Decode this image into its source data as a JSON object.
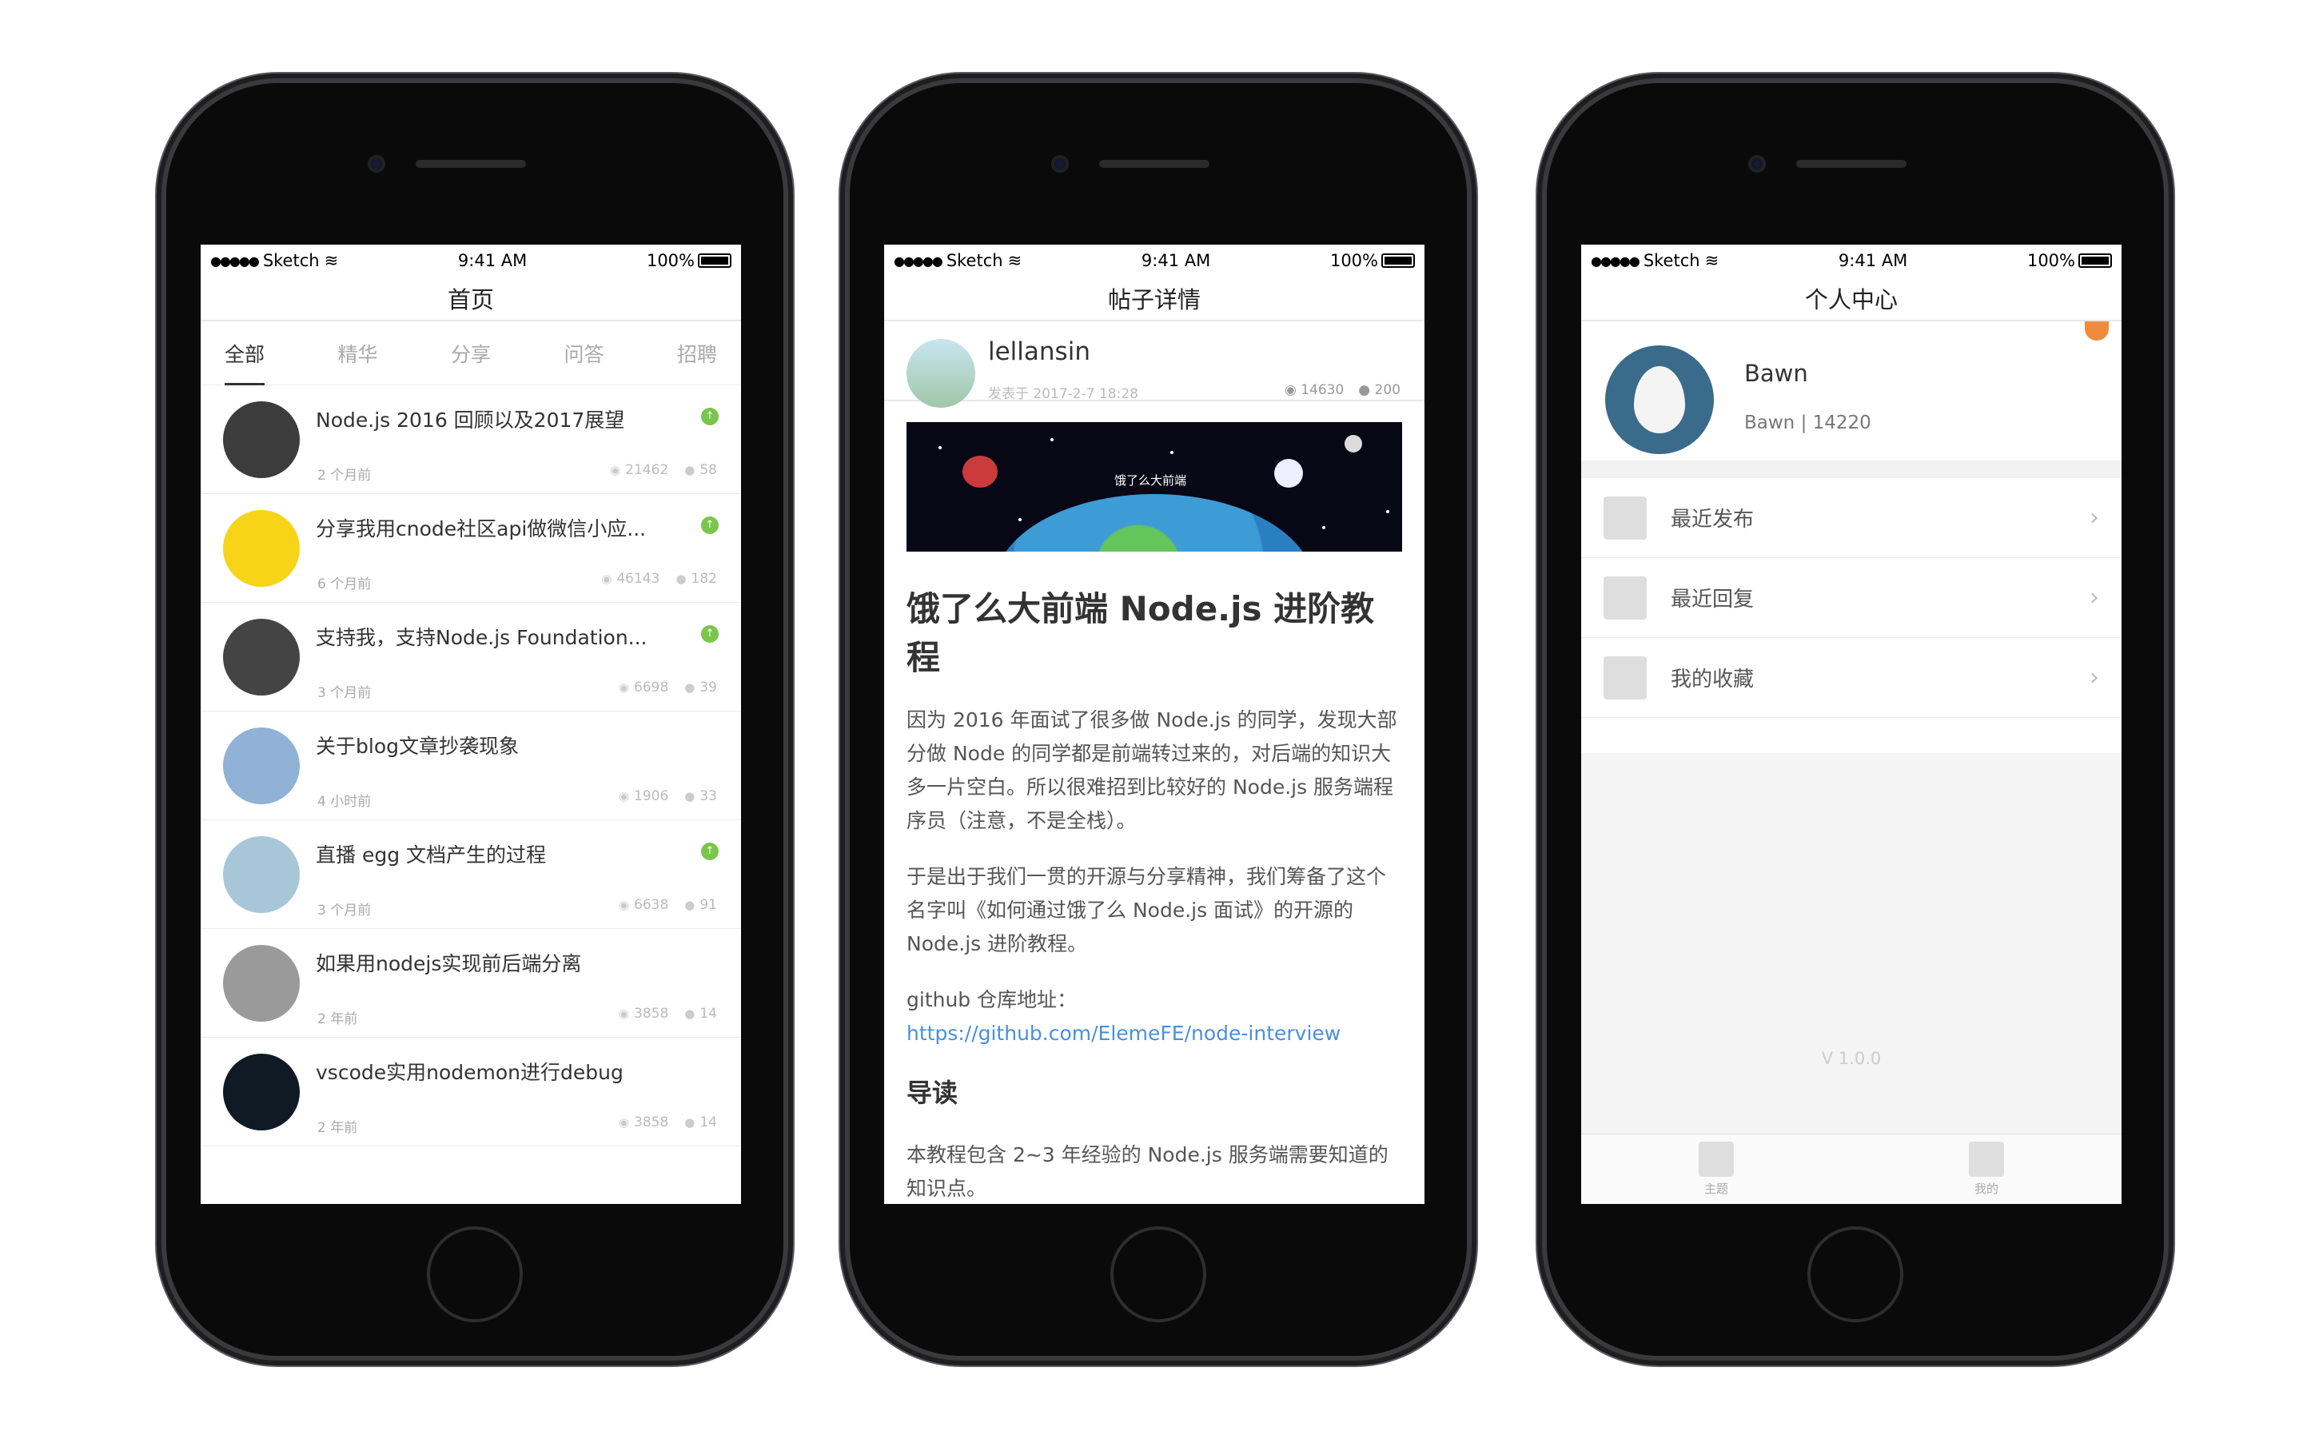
{
  "status": {
    "carrier": "Sketch",
    "time": "9:41 AM",
    "battery": "100%"
  },
  "phone1": {
    "title": "首页",
    "tabs": [
      "全部",
      "精华",
      "分享",
      "问答",
      "招聘"
    ],
    "topics": [
      {
        "title": "Node.js 2016 回顾以及2017展望",
        "time": "2 个月前",
        "views": "21462",
        "replies": "58",
        "pinned": true,
        "avatar_color": "#3c3c3c"
      },
      {
        "title": "分享我用cnode社区api做微信小应...",
        "time": "6 个月前",
        "views": "46143",
        "replies": "182",
        "pinned": true,
        "avatar_color": "#f7d417"
      },
      {
        "title": "支持我，支持Node.js Foundation...",
        "time": "3 个月前",
        "views": "6698",
        "replies": "39",
        "pinned": true,
        "avatar_color": "#444444"
      },
      {
        "title": "关于blog文章抄袭现象",
        "time": "4 小时前",
        "views": "1906",
        "replies": "33",
        "pinned": false,
        "avatar_color": "#8fb2d6"
      },
      {
        "title": "直播 egg 文档产生的过程",
        "time": "3 个月前",
        "views": "6638",
        "replies": "91",
        "pinned": true,
        "avatar_color": "#a7c6d8"
      },
      {
        "title": "如果用nodejs实现前后端分离",
        "time": "2 年前",
        "views": "3858",
        "replies": "14",
        "pinned": false,
        "avatar_color": "#9a9a9a"
      },
      {
        "title": "vscode实用nodemon进行debug",
        "time": "2 年前",
        "views": "3858",
        "replies": "14",
        "pinned": false,
        "avatar_color": "#0f1a25"
      }
    ]
  },
  "phone2": {
    "title": "帖子详情",
    "author": "lellansin",
    "date": "发表于 2017-2-7 18:28",
    "views": "14630",
    "replies": "200",
    "banner_text": "饿了么大前端",
    "heading": "饿了么大前端 Node.js 进阶教程",
    "para1": "因为 2016 年面试了很多做 Node.js 的同学，发现大部分做 Node 的同学都是前端转过来的，对后端的知识大多一片空白。所以很难招到比较好的 Node.js 服务端程序员（注意，不是全栈）。",
    "para2": "于是出于我们一贯的开源与分享精神，我们筹备了这个名字叫《如何通过饿了么 Node.js 面试》的开源的 Node.js 进阶教程。",
    "repo_prefix": "github 仓库地址：",
    "repo_link": "https://github.com/ElemeFE/node-interview",
    "subheading": "导读",
    "para3": "本教程包含 2~3 年经验的 Node.js 服务端需要知道的知识点。"
  },
  "phone3": {
    "title": "个人中心",
    "username": "Bawn",
    "info": "Bawn | 14220",
    "menu": [
      "最近发布",
      "最近回复",
      "我的收藏"
    ],
    "version": "V 1.0.0",
    "tabbar": [
      "主题",
      "我的"
    ]
  }
}
